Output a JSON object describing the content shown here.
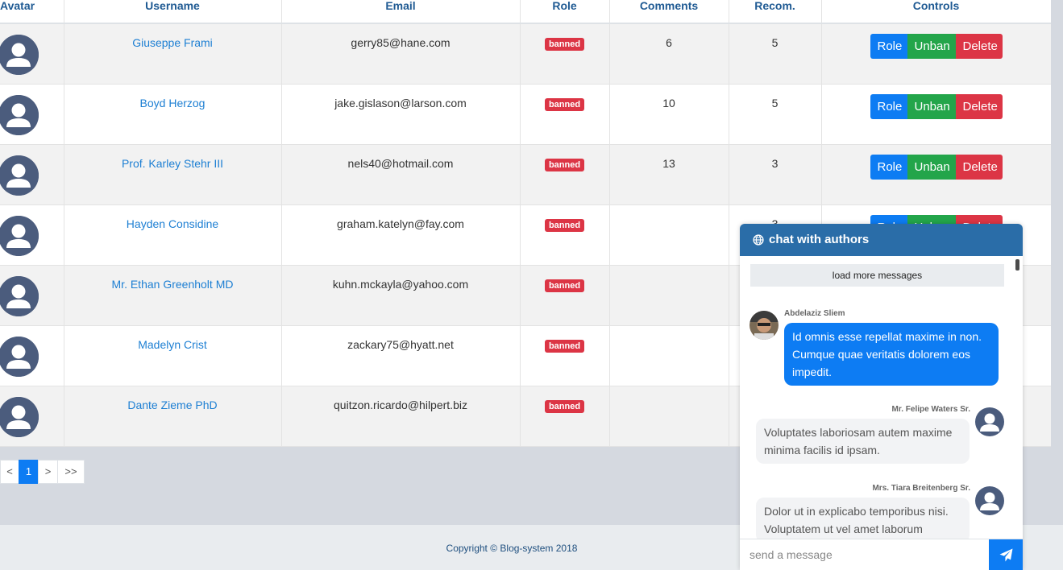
{
  "table": {
    "headers": [
      "Avatar",
      "Username",
      "Email",
      "Role",
      "Comments",
      "Recom.",
      "Controls"
    ],
    "rows": [
      {
        "username": "Giuseppe Frami",
        "email": "gerry85@hane.com",
        "role": "banned",
        "comments": "6",
        "recom": "5"
      },
      {
        "username": "Boyd Herzog",
        "email": "jake.gislason@larson.com",
        "role": "banned",
        "comments": "10",
        "recom": "5"
      },
      {
        "username": "Prof. Karley Stehr III",
        "email": "nels40@hotmail.com",
        "role": "banned",
        "comments": "13",
        "recom": "3"
      },
      {
        "username": "Hayden Considine",
        "email": "graham.katelyn@fay.com",
        "role": "banned",
        "comments": "",
        "recom": "3"
      },
      {
        "username": "Mr. Ethan Greenholt MD",
        "email": "kuhn.mckayla@yahoo.com",
        "role": "banned",
        "comments": "",
        "recom": ""
      },
      {
        "username": "Madelyn Crist",
        "email": "zackary75@hyatt.net",
        "role": "banned",
        "comments": "",
        "recom": ""
      },
      {
        "username": "Dante Zieme PhD",
        "email": "quitzon.ricardo@hilpert.biz",
        "role": "banned",
        "comments": "",
        "recom": ""
      }
    ],
    "controls": {
      "role": "Role",
      "unban": "Unban",
      "delete": "Delete"
    }
  },
  "pagination": {
    "prev": "<",
    "current": "1",
    "next": ">",
    "last": ">>"
  },
  "footer": {
    "copyright": "Copyright © Blog-system 2018"
  },
  "chat": {
    "title": "chat with authors",
    "load_more": "load more messages",
    "messages": [
      {
        "author": "Abdelaziz Sliem",
        "text": "Id omnis esse repellat maxime in non. Cumque quae veritatis dolorem eos impedit.",
        "mine": true
      },
      {
        "author": "Mr. Felipe Waters Sr.",
        "text": "Voluptates laboriosam autem maxime minima facilis id ipsam.",
        "mine": false
      },
      {
        "author": "Mrs. Tiara Breitenberg Sr.",
        "text": "Dolor ut in explicabo temporibus nisi. Voluptatem ut vel amet laborum",
        "mine": false
      }
    ],
    "input_placeholder": "send a message"
  },
  "colors": {
    "primary": "#0d7cf3",
    "success": "#23a54a",
    "danger": "#dc3545",
    "chat_header": "#2a6da8",
    "link": "#1d7fd3"
  },
  "icons": {
    "avatar": "user-silhouette-icon",
    "chat_header": "globe-icon",
    "send": "paper-plane-icon"
  }
}
